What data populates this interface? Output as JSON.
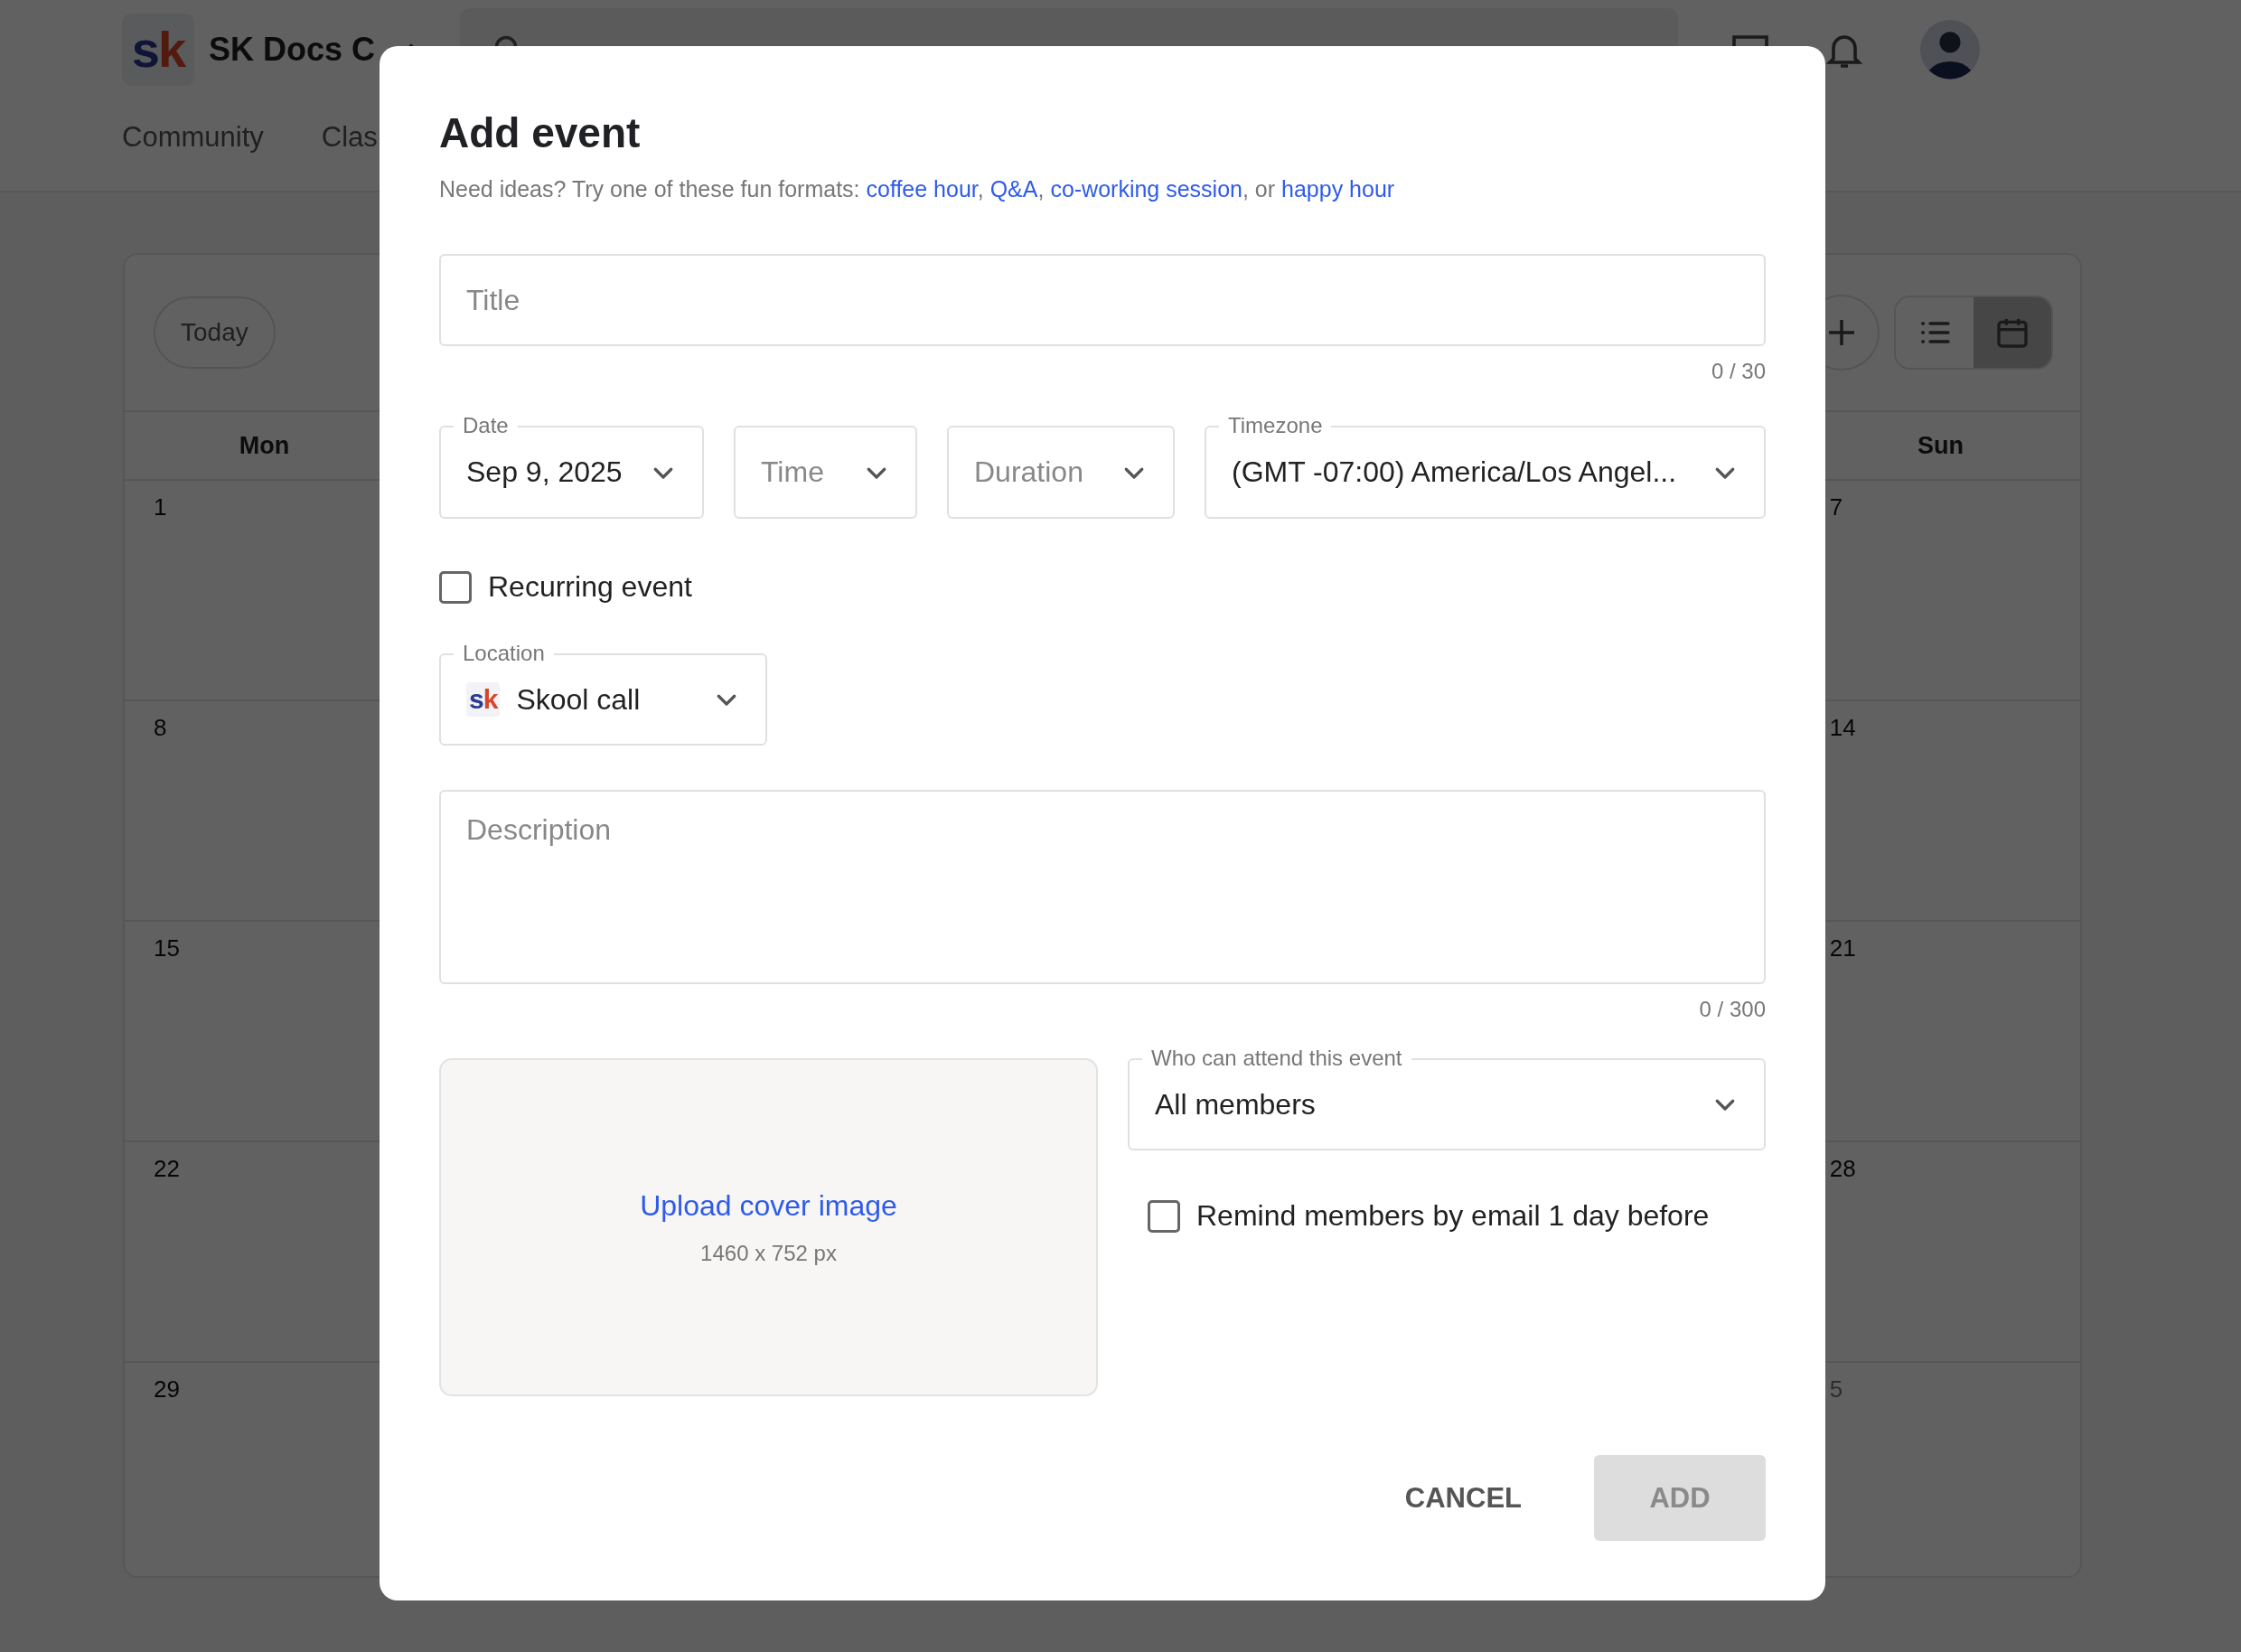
{
  "header": {
    "logo": [
      {
        "text": "s"
      },
      {
        "text": "k"
      }
    ],
    "community_name": "SK Docs C",
    "nav_tabs": [
      {
        "label": "Community"
      },
      {
        "label": "Clas"
      }
    ]
  },
  "calendar": {
    "today_button": "Today",
    "view_toggle": [
      {
        "kind": "list",
        "selected": false
      },
      {
        "kind": "calendar",
        "selected": true
      }
    ],
    "columns": [
      {
        "weekday": "Mon",
        "days": [
          {
            "day": "1",
            "other_month": false
          },
          {
            "day": "8",
            "other_month": false
          },
          {
            "day": "15",
            "other_month": false
          },
          {
            "day": "22",
            "other_month": false
          },
          {
            "day": "29",
            "other_month": false
          }
        ]
      },
      {
        "weekday": "Sun",
        "days": [
          {
            "day": "7",
            "other_month": false
          },
          {
            "day": "14",
            "other_month": false
          },
          {
            "day": "21",
            "other_month": false
          },
          {
            "day": "28",
            "other_month": false
          },
          {
            "day": "5",
            "other_month": true
          }
        ]
      }
    ]
  },
  "dialog": {
    "title": "Add event",
    "hint": [
      {
        "kind": "text",
        "text": "Need ideas? Try one of these fun formats: "
      },
      {
        "kind": "link",
        "text": "coffee hour"
      },
      {
        "kind": "text",
        "text": ", "
      },
      {
        "kind": "link",
        "text": "Q&A"
      },
      {
        "kind": "text",
        "text": ", "
      },
      {
        "kind": "link",
        "text": "co-working session"
      },
      {
        "kind": "text",
        "text": ", or "
      },
      {
        "kind": "link",
        "text": "happy hour"
      }
    ],
    "title_field": {
      "placeholder": "Title",
      "counter": "0 / 30"
    },
    "selects": [
      {
        "label": "Date",
        "value": "Sep 9, 2025"
      },
      {
        "placeholder": "Time"
      },
      {
        "placeholder": "Duration"
      },
      {
        "label": "Timezone",
        "value": "(GMT -07:00) America/Los Angel..."
      }
    ],
    "recurring": {
      "label": "Recurring event",
      "checked": false
    },
    "location": {
      "label": "Location",
      "logo": [
        {
          "text": "s",
          "color": "#2b3990"
        },
        {
          "text": "k",
          "color": "#d9452b"
        }
      ],
      "value": "Skool call"
    },
    "description": {
      "placeholder": "Description",
      "counter": "0 / 300"
    },
    "cover_upload": {
      "link": "Upload cover image",
      "size_hint": "1460 x 752 px"
    },
    "audience": {
      "label": "Who can attend this event",
      "value": "All members"
    },
    "reminder": {
      "label": "Remind members by email 1 day before",
      "checked": false
    },
    "buttons": [
      {
        "label": "CANCEL",
        "kind": "text",
        "disabled": false
      },
      {
        "label": "ADD",
        "kind": "filled",
        "disabled": true
      }
    ]
  }
}
